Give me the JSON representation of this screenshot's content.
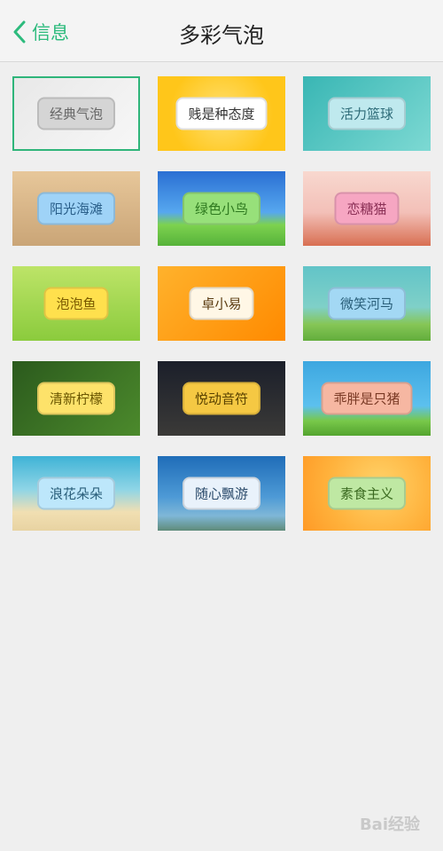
{
  "header": {
    "back_label": "信息",
    "title": "多彩气泡"
  },
  "bubbles": [
    {
      "label": "经典气泡",
      "selected": true,
      "bg": "linear-gradient(135deg,#e8e8e8,#f7f7f7)",
      "bubble_bg": "#d5d5d5",
      "text_color": "#666666"
    },
    {
      "label": "贱是种态度",
      "bg": "radial-gradient(circle,#ffe070 0%,#ffc61a 70%)",
      "bubble_bg": "#ffffff",
      "text_color": "#333333"
    },
    {
      "label": "活力篮球",
      "bg": "linear-gradient(135deg,#39b6b4,#7dd9d3)",
      "bubble_bg": "#bfe9ee",
      "text_color": "#2d6b78"
    },
    {
      "label": "阳光海滩",
      "bg": "linear-gradient(180deg,#e7c79a,#caa577)",
      "bubble_bg": "#9fd3f7",
      "text_color": "#2a5f8a"
    },
    {
      "label": "绿色小鸟",
      "bg": "linear-gradient(180deg,#2a6fd3 0%,#56a7ef 55%,#7dd24f 72%,#56b23a 100%)",
      "bubble_bg": "#97e07a",
      "text_color": "#2f7a20"
    },
    {
      "label": "恋糖猫",
      "bg": "linear-gradient(180deg,#f8d8cf 0%,#f3c0b8 55%,#d86f52 100%)",
      "bubble_bg": "#f6a6c2",
      "text_color": "#8a2f55"
    },
    {
      "label": "泡泡鱼",
      "bg": "linear-gradient(180deg,#bde468,#8bcb3d)",
      "bubble_bg": "#ffe04d",
      "text_color": "#7a5a00"
    },
    {
      "label": "卓小易",
      "bg": "linear-gradient(135deg,#ffb22c,#ff8a00)",
      "bubble_bg": "#fff7e6",
      "text_color": "#5a3b10"
    },
    {
      "label": "微笑河马",
      "bg": "linear-gradient(180deg,#62c4c8 0%,#7fd0c8 55%,#86c656 78%,#62ad3c 100%)",
      "bubble_bg": "#a3d8f4",
      "text_color": "#2a5f7a"
    },
    {
      "label": "清新柠檬",
      "bg": "linear-gradient(135deg,#2b5a1d,#4c8a2c)",
      "bubble_bg": "#fde26a",
      "text_color": "#6a5600"
    },
    {
      "label": "悦动音符",
      "bg": "linear-gradient(180deg,#1b1f2a,#3b3a38)",
      "bubble_bg": "#f5c843",
      "text_color": "#5a4200"
    },
    {
      "label": "乖胖是只猪",
      "bg": "linear-gradient(180deg,#3da7e0 0%,#5cc0ee 60%,#78c84a 80%,#54a42f 100%)",
      "bubble_bg": "#f6b7a2",
      "text_color": "#7a3a25"
    },
    {
      "label": "浪花朵朵",
      "bg": "linear-gradient(180deg,#3fb3d6 0%,#8fd5e6 45%,#f1dfb2 75%,#e8d3a2 100%)",
      "bubble_bg": "#bde7fb",
      "text_color": "#2a5f7a"
    },
    {
      "label": "随心飘游",
      "bg": "linear-gradient(180deg,#1f6db8 0%,#4e9ad6 55%,#7fb7d7 80%,#5f8b7a 100%)",
      "bubble_bg": "#e9f2fb",
      "text_color": "#2a4a6a"
    },
    {
      "label": "素食主义",
      "bg": "radial-gradient(circle at 60% 40%,#ffd36a 0%,#ffb13b 60%,#ff9a26 100%)",
      "bubble_bg": "#bfe8a3",
      "text_color": "#3b6a20"
    }
  ],
  "watermark": "Bai经验"
}
